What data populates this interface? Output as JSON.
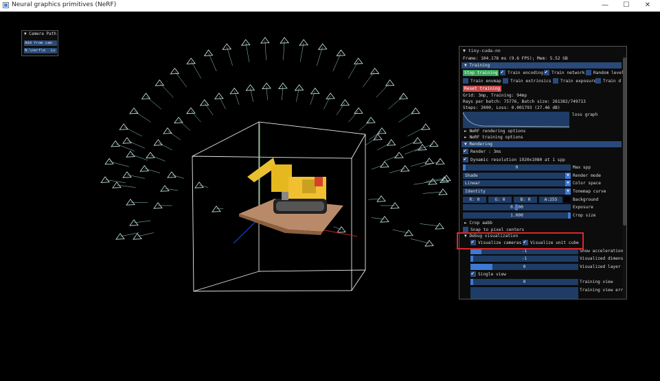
{
  "window": {
    "title": "Neural graphics primitives (NeRF)",
    "minimize": "—",
    "maximize": "☐",
    "close": "✕"
  },
  "camera_path": {
    "header": "▼ Camera Path",
    "add_from_cam": "Add from cam",
    "path_field": "N:\\nerf\\m",
    "load_button": "Lo"
  },
  "panel": {
    "title": "▼ tiny-cuda-nn",
    "frame_info": "Frame: 104.178 ms (9.6 FPS); Mem: 5.52 GB",
    "training_header": "▼ Training",
    "stop_training": "Stop training",
    "train_encoding": "Train encoding",
    "train_network": "Train network",
    "random_levels": "Random level",
    "train_envmap": "Train envmap",
    "train_extrinsics": "Train extrinsics",
    "train_exposure": "Train exposure",
    "train_distortion": "Train d",
    "reset_training": "Reset training",
    "grid_info": "Grid: 3mp, Training: 94mp",
    "rays_info": "Rays per batch: 75776, Batch size: 261382/749713",
    "steps_info": "Steps: 2000, Loss: 0.001793 (27.46 dB)",
    "loss_graph": "loss graph",
    "nerf_rendering_options": "► NeRF rendering options",
    "nerf_training_options": "► NeRF training options",
    "rendering_header": "▼ Rendering",
    "render_label": "Render : 3ms",
    "dynamic_resolution": "Dynamic resolution 1920x1080 at 1 spp",
    "max_spp_value": "0",
    "max_spp_label": "Max spp",
    "render_mode_value": "Shade",
    "render_mode_label": "Render mode",
    "color_space_value": "Linear",
    "color_space_label": "Color space",
    "tonemap_value": "Identity",
    "tonemap_label": "Tonemap curve",
    "bg_r": "R:  0",
    "bg_g": "G:  0",
    "bg_b": "B:  0",
    "bg_a": "A:255",
    "background_label": "Background",
    "exposure_value": "0.000",
    "exposure_label": "Exposure",
    "crop_value": "1.000",
    "crop_label": "Crop size",
    "crop_aabb": "► Crop aabb",
    "snap_pixel": "Snap to pixel centers",
    "debug_header": "▼ Debug visualization",
    "visualize_cameras": "Visualize cameras",
    "visualize_unit_cube": "Visualize unit cube",
    "show_accel_value": "-1",
    "show_accel_label": "Show acceleration",
    "vis_dim_value": "-1",
    "vis_dim_label": "Visualized dimens",
    "vis_layer_value": "0",
    "vis_layer_label": "Visualized layer",
    "single_view": "Single view",
    "training_view_value": "0",
    "training_view_label": "Training view",
    "training_view_err_label": "Training view err"
  },
  "colors": {
    "header_blue": "#294a7a",
    "field_blue": "#1e3c66",
    "accent_blue": "#3d7ad6",
    "stop_green": "#3aa35a",
    "reset_red": "#c24a4a",
    "highlight_red": "#e0262a"
  }
}
